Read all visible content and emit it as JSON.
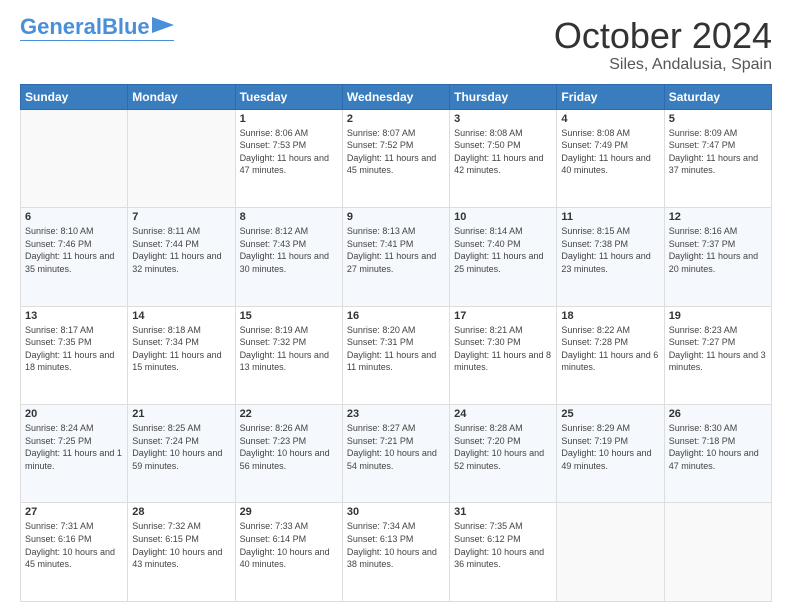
{
  "logo": {
    "line1": "General",
    "line2": "Blue"
  },
  "title": "October 2024",
  "subtitle": "Siles, Andalusia, Spain",
  "days_of_week": [
    "Sunday",
    "Monday",
    "Tuesday",
    "Wednesday",
    "Thursday",
    "Friday",
    "Saturday"
  ],
  "weeks": [
    [
      {
        "day": "",
        "info": ""
      },
      {
        "day": "",
        "info": ""
      },
      {
        "day": "1",
        "info": "Sunrise: 8:06 AM\nSunset: 7:53 PM\nDaylight: 11 hours and 47 minutes."
      },
      {
        "day": "2",
        "info": "Sunrise: 8:07 AM\nSunset: 7:52 PM\nDaylight: 11 hours and 45 minutes."
      },
      {
        "day": "3",
        "info": "Sunrise: 8:08 AM\nSunset: 7:50 PM\nDaylight: 11 hours and 42 minutes."
      },
      {
        "day": "4",
        "info": "Sunrise: 8:08 AM\nSunset: 7:49 PM\nDaylight: 11 hours and 40 minutes."
      },
      {
        "day": "5",
        "info": "Sunrise: 8:09 AM\nSunset: 7:47 PM\nDaylight: 11 hours and 37 minutes."
      }
    ],
    [
      {
        "day": "6",
        "info": "Sunrise: 8:10 AM\nSunset: 7:46 PM\nDaylight: 11 hours and 35 minutes."
      },
      {
        "day": "7",
        "info": "Sunrise: 8:11 AM\nSunset: 7:44 PM\nDaylight: 11 hours and 32 minutes."
      },
      {
        "day": "8",
        "info": "Sunrise: 8:12 AM\nSunset: 7:43 PM\nDaylight: 11 hours and 30 minutes."
      },
      {
        "day": "9",
        "info": "Sunrise: 8:13 AM\nSunset: 7:41 PM\nDaylight: 11 hours and 27 minutes."
      },
      {
        "day": "10",
        "info": "Sunrise: 8:14 AM\nSunset: 7:40 PM\nDaylight: 11 hours and 25 minutes."
      },
      {
        "day": "11",
        "info": "Sunrise: 8:15 AM\nSunset: 7:38 PM\nDaylight: 11 hours and 23 minutes."
      },
      {
        "day": "12",
        "info": "Sunrise: 8:16 AM\nSunset: 7:37 PM\nDaylight: 11 hours and 20 minutes."
      }
    ],
    [
      {
        "day": "13",
        "info": "Sunrise: 8:17 AM\nSunset: 7:35 PM\nDaylight: 11 hours and 18 minutes."
      },
      {
        "day": "14",
        "info": "Sunrise: 8:18 AM\nSunset: 7:34 PM\nDaylight: 11 hours and 15 minutes."
      },
      {
        "day": "15",
        "info": "Sunrise: 8:19 AM\nSunset: 7:32 PM\nDaylight: 11 hours and 13 minutes."
      },
      {
        "day": "16",
        "info": "Sunrise: 8:20 AM\nSunset: 7:31 PM\nDaylight: 11 hours and 11 minutes."
      },
      {
        "day": "17",
        "info": "Sunrise: 8:21 AM\nSunset: 7:30 PM\nDaylight: 11 hours and 8 minutes."
      },
      {
        "day": "18",
        "info": "Sunrise: 8:22 AM\nSunset: 7:28 PM\nDaylight: 11 hours and 6 minutes."
      },
      {
        "day": "19",
        "info": "Sunrise: 8:23 AM\nSunset: 7:27 PM\nDaylight: 11 hours and 3 minutes."
      }
    ],
    [
      {
        "day": "20",
        "info": "Sunrise: 8:24 AM\nSunset: 7:25 PM\nDaylight: 11 hours and 1 minute."
      },
      {
        "day": "21",
        "info": "Sunrise: 8:25 AM\nSunset: 7:24 PM\nDaylight: 10 hours and 59 minutes."
      },
      {
        "day": "22",
        "info": "Sunrise: 8:26 AM\nSunset: 7:23 PM\nDaylight: 10 hours and 56 minutes."
      },
      {
        "day": "23",
        "info": "Sunrise: 8:27 AM\nSunset: 7:21 PM\nDaylight: 10 hours and 54 minutes."
      },
      {
        "day": "24",
        "info": "Sunrise: 8:28 AM\nSunset: 7:20 PM\nDaylight: 10 hours and 52 minutes."
      },
      {
        "day": "25",
        "info": "Sunrise: 8:29 AM\nSunset: 7:19 PM\nDaylight: 10 hours and 49 minutes."
      },
      {
        "day": "26",
        "info": "Sunrise: 8:30 AM\nSunset: 7:18 PM\nDaylight: 10 hours and 47 minutes."
      }
    ],
    [
      {
        "day": "27",
        "info": "Sunrise: 7:31 AM\nSunset: 6:16 PM\nDaylight: 10 hours and 45 minutes."
      },
      {
        "day": "28",
        "info": "Sunrise: 7:32 AM\nSunset: 6:15 PM\nDaylight: 10 hours and 43 minutes."
      },
      {
        "day": "29",
        "info": "Sunrise: 7:33 AM\nSunset: 6:14 PM\nDaylight: 10 hours and 40 minutes."
      },
      {
        "day": "30",
        "info": "Sunrise: 7:34 AM\nSunset: 6:13 PM\nDaylight: 10 hours and 38 minutes."
      },
      {
        "day": "31",
        "info": "Sunrise: 7:35 AM\nSunset: 6:12 PM\nDaylight: 10 hours and 36 minutes."
      },
      {
        "day": "",
        "info": ""
      },
      {
        "day": "",
        "info": ""
      }
    ]
  ]
}
